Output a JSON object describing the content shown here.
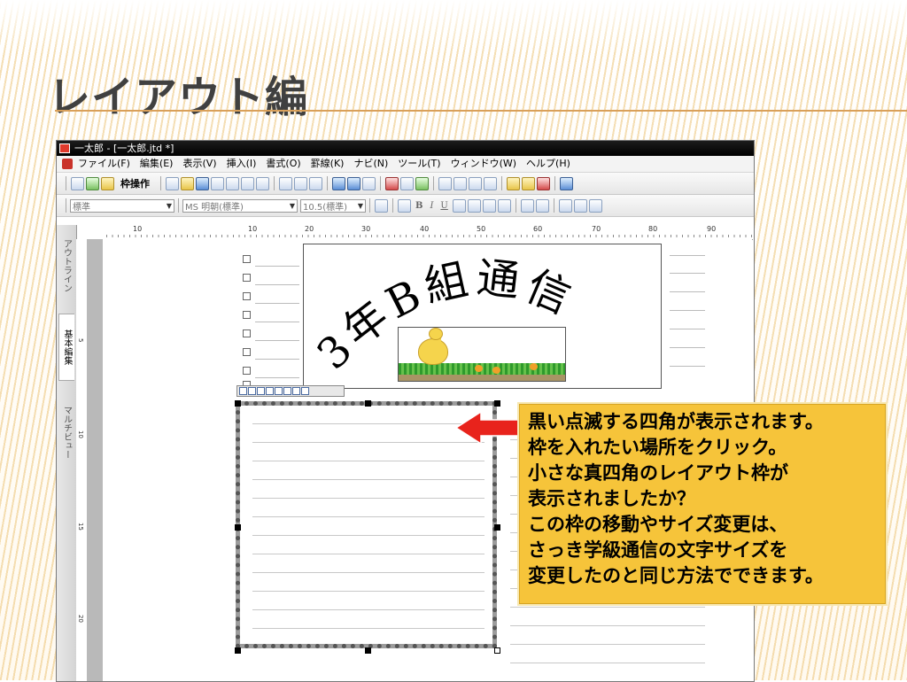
{
  "slide": {
    "title": "レイアウト編"
  },
  "window": {
    "title": "一太郎 - [一太郎.jtd *]"
  },
  "menu": {
    "items": [
      "ファイル(F)",
      "編集(E)",
      "表示(V)",
      "挿入(I)",
      "書式(O)",
      "罫線(K)",
      "ナビ(N)",
      "ツール(T)",
      "ウィンドウ(W)",
      "ヘルプ(H)"
    ]
  },
  "toolbar": {
    "frame_op_label": "枠操作"
  },
  "format_bar": {
    "style_value": "標準",
    "font_value": "MS 明朝(標準)",
    "size_value": "10.5(標準)",
    "bold": "B",
    "italic": "I",
    "underline": "U"
  },
  "ruler": {
    "labels": [
      "10",
      "10",
      "20",
      "30",
      "40",
      "50",
      "60",
      "70",
      "80",
      "90"
    ]
  },
  "vruler": {
    "labels": [
      "5",
      "10",
      "15",
      "20"
    ]
  },
  "sidebar": {
    "tabs": [
      "アウトライン",
      "基本編集",
      "マルチビュー"
    ]
  },
  "document": {
    "banner_text": "3年B組通信"
  },
  "callout": {
    "lines": [
      "黒い点滅する四角が表示されます。",
      "枠を入れたい場所をクリック。",
      "小さな真四角のレイアウト枠が",
      "表示されましたか？",
      "この枠の移動やサイズ変更は、",
      "さっき学級通信の文字サイズを",
      "変更したのと同じ方法でできます。"
    ]
  },
  "colors": {
    "callout_bg": "#f6c43a",
    "arrow": "#e8231c",
    "title_rule": "#d9a05a"
  }
}
